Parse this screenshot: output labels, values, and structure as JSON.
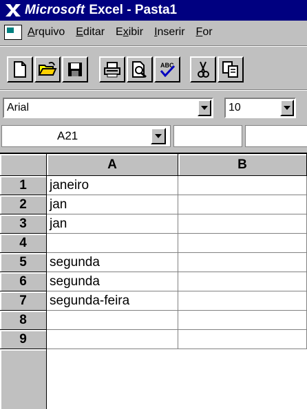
{
  "window": {
    "brand": "Microsoft",
    "title_rest": "Excel - Pasta1",
    "title_color": "#000080"
  },
  "menu": {
    "items": [
      {
        "label_pre": "",
        "mnemonic": "A",
        "label_post": "rquivo"
      },
      {
        "label_pre": "",
        "mnemonic": "E",
        "label_post": "ditar"
      },
      {
        "label_pre": "E",
        "mnemonic": "x",
        "label_post": "ibir"
      },
      {
        "label_pre": "",
        "mnemonic": "I",
        "label_post": "nserir"
      },
      {
        "label_pre": "",
        "mnemonic": "F",
        "label_post": "or"
      }
    ]
  },
  "toolbar": {
    "buttons": [
      "new-icon",
      "open-icon",
      "save-icon",
      "print-icon",
      "print-preview-icon",
      "spelling-icon",
      "cut-icon",
      "copy-icon"
    ]
  },
  "format": {
    "font": "Arial",
    "size": "10"
  },
  "name_box": {
    "value": "A21"
  },
  "grid": {
    "columns": [
      "A",
      "B"
    ],
    "rows": [
      {
        "n": "1",
        "a": "janeiro",
        "b": ""
      },
      {
        "n": "2",
        "a": "jan",
        "b": ""
      },
      {
        "n": "3",
        "a": "jan",
        "b": ""
      },
      {
        "n": "4",
        "a": "",
        "b": ""
      },
      {
        "n": "5",
        "a": "segunda",
        "b": ""
      },
      {
        "n": "6",
        "a": "segunda",
        "b": ""
      },
      {
        "n": "7",
        "a": "segunda-feira",
        "b": ""
      },
      {
        "n": "8",
        "a": "",
        "b": ""
      },
      {
        "n": "9",
        "a": "",
        "b": ""
      }
    ]
  }
}
